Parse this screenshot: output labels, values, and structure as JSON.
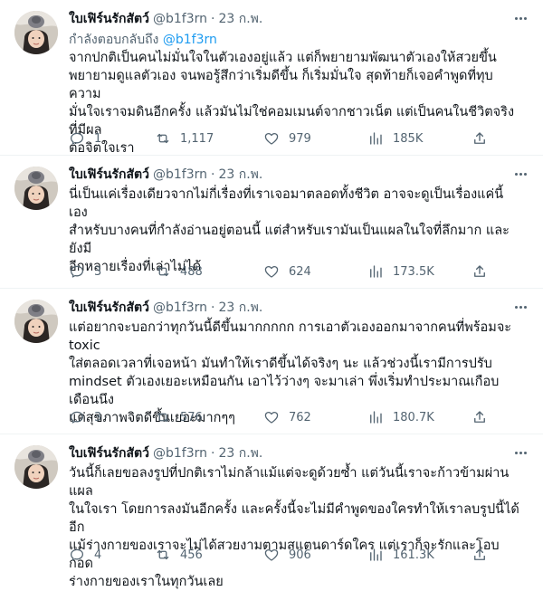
{
  "tweets": [
    {
      "display_name": "ใบเฟิร์นรักสัตว์",
      "handle": "@b1f3rn",
      "dot": "·",
      "date": "23 ก.พ.",
      "reply_prefix": "กำลังตอบกลับถึง",
      "reply_mention": "@b1f3rn",
      "text": "จากปกติเป็นคนไม่มั่นใจในตัวเองอยู่แล้ว แต่ก็พยายามพัฒนาตัวเองให้สวยขึ้น\nพยายามดูแลตัวเอง จนพอรู้สึกว่าเริ่มดีขึ้น ก็เริ่มมั่นใจ สุดท้ายก็เจอคำพูดที่ทุบความ\nมั่นใจเราจมดินอีกครั้ง แล้วมันไม่ใช่คอมเมนต์จากชาวเน็ต แต่เป็นคนในชีวิตจริงที่มีผล\nต่อจิตใจเรา",
      "replies": "1",
      "retweets": "1,117",
      "likes": "979",
      "views": "185K",
      "icons": {
        "reply": "reply-icon",
        "retweet": "retweet-icon",
        "like": "heart-icon",
        "views": "views-chart-icon",
        "share": "share-icon"
      }
    },
    {
      "display_name": "ใบเฟิร์นรักสัตว์",
      "handle": "@b1f3rn",
      "dot": "·",
      "date": "23 ก.พ.",
      "text": "นี่เป็นแค่เรื่องเดียวจากไม่กี่เรื่องที่เราเจอมาตลอดทั้งชีวิต อาจจะดูเป็นเรื่องแค่นี้เอง\nสำหรับบางคนที่กำลังอ่านอยู่ตอนนี้ แต่สำหรับเรามันเป็นแผลในใจที่ลึกมาก และยังมี\nอีกหลายเรื่องที่เล่าไม่ได้",
      "replies": "3",
      "retweets": "488",
      "likes": "624",
      "views": "173.5K"
    },
    {
      "display_name": "ใบเฟิร์นรักสัตว์",
      "handle": "@b1f3rn",
      "dot": "·",
      "date": "23 ก.พ.",
      "text": "แต่อยากจะบอกว่าทุกวันนี้ดีขึ้นมากกกกก การเอาตัวเองออกมาจากคนที่พร้อมจะ toxic\nใส่ตลอดเวลาที่เจอหน้า มันทำให้เราดีขึ้นได้จริงๆ นะ แล้วช่วงนี้เรามีการปรับ\nmindset ตัวเองเยอะเหมือนกัน เอาไว้ว่างๆ จะมาเล่า พึ่งเริ่มทำประมาณเกือบเดือนนึง\nแต่สุขภาพจิตดีขึ้นเยอะมากๆๆ",
      "replies": "3",
      "retweets": "576",
      "likes": "762",
      "views": "180.7K"
    },
    {
      "display_name": "ใบเฟิร์นรักสัตว์",
      "handle": "@b1f3rn",
      "dot": "·",
      "date": "23 ก.พ.",
      "text": "วันนี้ก็เลยขอลงรูปที่ปกติเราไม่กล้าแม้แต่จะดูด้วยซ้ำ แต่วันนี้เราจะก้าวข้ามผ่านแผล\nในใจเรา โดยการลงมันอีกครั้ง และครั้งนี้จะไม่มีคำพูดของใครทำให้เราลบรูปนี้ได้อีก\nแม้ร่างกายของเราจะไม่ได้สวยงามตามสแตนดาร์ดใคร แต่เราก็จะรักและโอบกอด\nร่างกายของเราในทุกวันเลย",
      "replies": "4",
      "retweets": "456",
      "likes": "906",
      "views": "161.3K"
    }
  ],
  "colors": {
    "text": "#0f1419",
    "secondary": "#536471",
    "link": "#1d9bf0",
    "divider": "#eff3f4"
  }
}
